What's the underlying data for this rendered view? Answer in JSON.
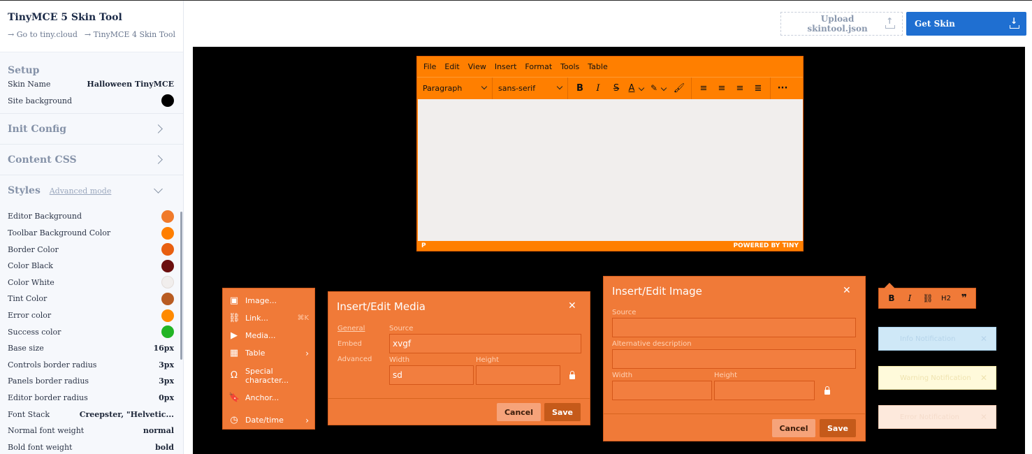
{
  "app": {
    "title": "TinyMCE 5 Skin Tool",
    "link_tiny_cloud": "→ Go to tiny.cloud",
    "link_tinymce4": "→ TinyMCE 4 Skin Tool"
  },
  "sidebar": {
    "setup": {
      "heading": "Setup",
      "skin_name_label": "Skin Name",
      "skin_name_value": "Halloween TinyMCE",
      "site_bg_label": "Site background",
      "site_bg_color": "#000000"
    },
    "init_config": "Init Config",
    "content_css": "Content CSS",
    "styles": {
      "heading": "Styles",
      "advanced_mode": "Advanced mode",
      "colors": [
        {
          "label": "Editor Background",
          "color": "#f07a2a"
        },
        {
          "label": "Toolbar Background Color",
          "color": "#ff7f00"
        },
        {
          "label": "Border Color",
          "color": "#e85f10"
        },
        {
          "label": "Color Black",
          "color": "#6b0f0f"
        },
        {
          "label": "Color White",
          "color": "#f1eeed"
        },
        {
          "label": "Tint Color",
          "color": "#b85c22"
        },
        {
          "label": "Error color",
          "color": "#ff8a00"
        },
        {
          "label": "Success color",
          "color": "#22b525"
        }
      ],
      "values": [
        {
          "label": "Base size",
          "value": "16px"
        },
        {
          "label": "Controls border radius",
          "value": "3px"
        },
        {
          "label": "Panels border radius",
          "value": "3px"
        },
        {
          "label": "Editor border radius",
          "value": "0px"
        },
        {
          "label": "Font Stack",
          "value": "Creepster, \"Helvetic..."
        },
        {
          "label": "Normal font weight",
          "value": "normal"
        },
        {
          "label": "Bold font weight",
          "value": "bold"
        }
      ]
    }
  },
  "topbar": {
    "upload_label": "Upload skintool.json",
    "get_skin_label": "Get Skin"
  },
  "editor": {
    "menu": [
      "File",
      "Edit",
      "View",
      "Insert",
      "Format",
      "Tools",
      "Table"
    ],
    "block_format": "Paragraph",
    "font_family": "sans-serif",
    "status_path": "P",
    "powered_by": "POWERED BY TINY"
  },
  "context_menu": {
    "items": [
      {
        "label": "Image...",
        "shortcut": ""
      },
      {
        "label": "Link...",
        "shortcut": "⌘K"
      },
      {
        "label": "Media...",
        "shortcut": ""
      },
      {
        "label": "Table",
        "shortcut": ""
      },
      {
        "label": "Special character...",
        "shortcut": ""
      },
      {
        "label": "Anchor...",
        "shortcut": ""
      },
      {
        "label": "Date/time",
        "shortcut": ""
      }
    ]
  },
  "media_dialog": {
    "title": "Insert/Edit Media",
    "tabs": [
      "General",
      "Embed",
      "Advanced"
    ],
    "source_label": "Source",
    "source_value": "xvgf",
    "width_label": "Width",
    "width_value": "sd",
    "height_label": "Height",
    "height_value": "",
    "cancel": "Cancel",
    "save": "Save"
  },
  "image_dialog": {
    "title": "Insert/Edit Image",
    "source_label": "Source",
    "alt_label": "Alternative description",
    "width_label": "Width",
    "height_label": "Height",
    "cancel": "Cancel",
    "save": "Save"
  },
  "inline_toolbar": {
    "h2": "H2"
  },
  "notifications": [
    {
      "label": "Info Notification",
      "bg": "#cfe8f7",
      "border": "#a9d2ee",
      "color": "#b6d4ea"
    },
    {
      "label": "Warning Notification",
      "bg": "#fffadb",
      "border": "#f5e8a6",
      "color": "#efe3b0"
    },
    {
      "label": "Error Notification",
      "bg": "#fde9dc",
      "border": "#f7d0b8",
      "color": "#f5dccb"
    }
  ]
}
